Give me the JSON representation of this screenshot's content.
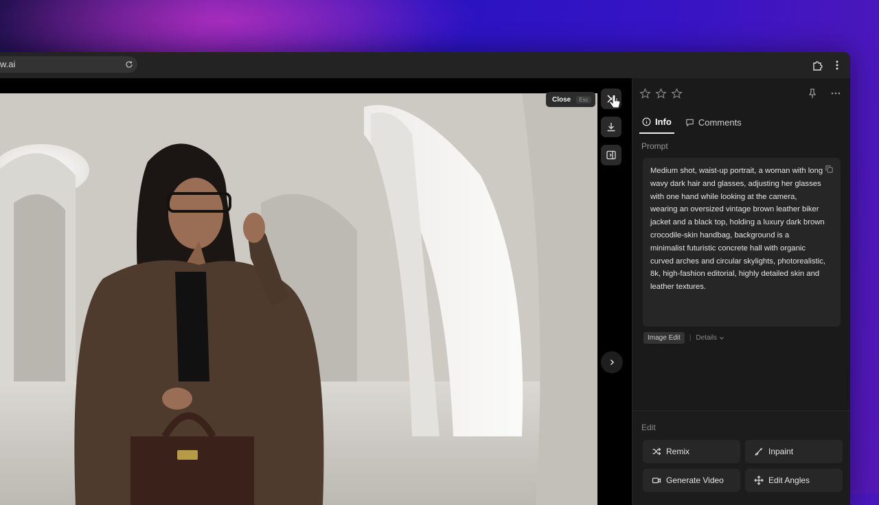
{
  "browser": {
    "url_fragment": "w.ai",
    "icons": [
      "reload-icon",
      "extensions-icon",
      "more-vertical-icon"
    ]
  },
  "viewer": {
    "close_tooltip": {
      "label": "Close",
      "shortcut": "Esc"
    },
    "toolbar_icons": [
      "close-icon",
      "download-icon",
      "side-panel-toggle-icon"
    ],
    "next_icon": "chevron-right-icon"
  },
  "panel": {
    "rating": {
      "stars": 3,
      "filled": 0
    },
    "top_icons": [
      "pin-icon",
      "more-horizontal-icon"
    ],
    "tabs": [
      {
        "label": "Info",
        "icon": "info-icon",
        "active": true
      },
      {
        "label": "Comments",
        "icon": "comment-icon",
        "active": false
      }
    ],
    "prompt_label": "Prompt",
    "prompt_text": "Medium shot, waist-up portrait, a woman with long wavy dark hair and glasses, adjusting her glasses with one hand while looking at the camera, wearing an oversized vintage brown leather biker jacket and a black top, holding a luxury dark brown crocodile-skin handbag, background is a minimalist futuristic concrete hall with organic curved arches and circular skylights, photorealistic, 8k, high-fashion editorial, highly detailed skin and leather textures.",
    "badge": "Image Edit",
    "details_label": "Details",
    "edit_label": "Edit",
    "edit_buttons": [
      {
        "label": "Remix",
        "icon": "shuffle-icon"
      },
      {
        "label": "Inpaint",
        "icon": "brush-icon"
      },
      {
        "label": "Generate Video",
        "icon": "video-icon"
      },
      {
        "label": "Edit Angles",
        "icon": "move-icon"
      }
    ]
  },
  "colors": {
    "panel_bg": "#1a1a1a",
    "prompt_bg": "#262626",
    "accent_gradient": [
      "#5a1aa8",
      "#2a13c2"
    ]
  }
}
